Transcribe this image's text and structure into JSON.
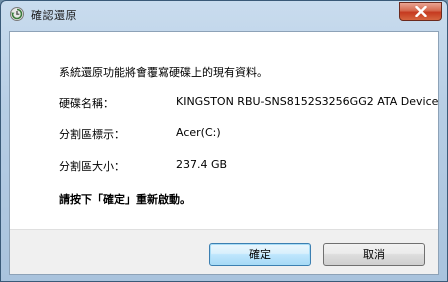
{
  "window": {
    "title": "確認還原"
  },
  "dialog": {
    "message": "系統還原功能將會覆寫硬碟上的現有資料。",
    "rows": [
      {
        "label": "硬碟名稱：",
        "value": "KINGSTON RBU-SNS8152S3256GG2 ATA Device"
      },
      {
        "label": "分割區標示：",
        "value": "Acer(C:)"
      },
      {
        "label": "分割區大小：",
        "value": "237.4 GB"
      }
    ],
    "instruction": "請按下「確定」重新啟動。"
  },
  "buttons": {
    "ok_label": "確定",
    "cancel_label": "取消"
  },
  "icons": {
    "app": "restore-icon",
    "close": "close-icon"
  },
  "colors": {
    "close_button": "#c5391f",
    "default_button_border": "#3c7fb1"
  }
}
